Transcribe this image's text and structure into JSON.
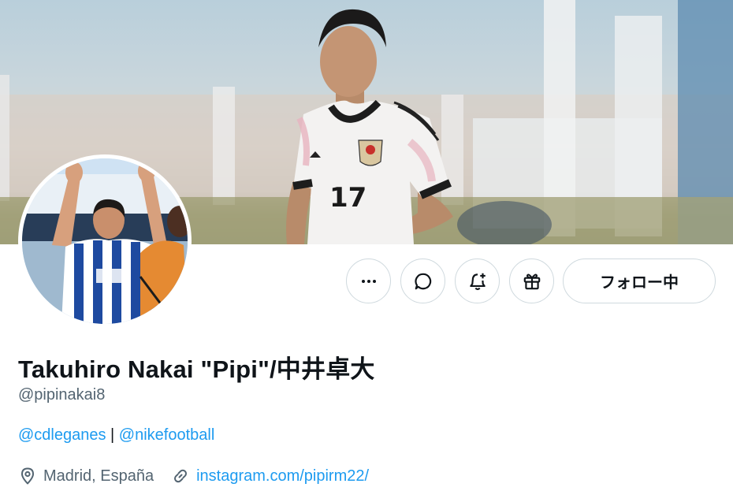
{
  "profile": {
    "display_name": "Takuhiro Nakai \"Pipi\"/中井卓大",
    "handle": "@pipinakai8",
    "bio": {
      "mention_1": "@cdleganes",
      "separator": " | ",
      "mention_2": "@nikefootball"
    },
    "location": "Madrid, España",
    "website": "instagram.com/pipirm22/"
  },
  "banner": {
    "jersey_number": "17"
  },
  "actions": {
    "more_icon": "more-horizontal-icon",
    "message_icon": "message-bubble-icon",
    "notify_icon": "bell-plus-icon",
    "gift_icon": "gift-icon",
    "follow_label": "フォロー中"
  },
  "colors": {
    "link": "#1d9bf0",
    "secondary_text": "#536471",
    "border": "#cfd9de"
  }
}
